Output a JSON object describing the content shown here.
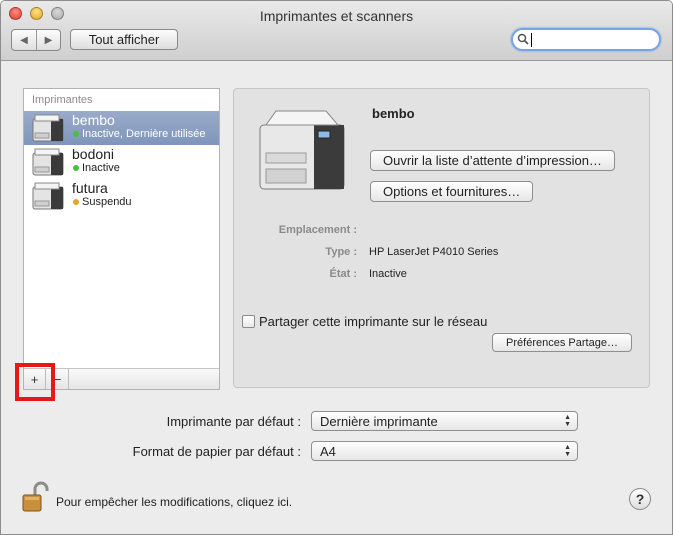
{
  "window": {
    "title": "Imprimantes et scanners"
  },
  "toolbar": {
    "back_icon": "triangle-left-icon",
    "forward_icon": "triangle-right-icon",
    "show_all_label": "Tout afficher",
    "search_value": ""
  },
  "printers_list": {
    "header": "Imprimantes",
    "items": [
      {
        "name": "bembo",
        "status": "Inactive, Dernière utilisée",
        "status_color": "#4bbf3f",
        "selected": true
      },
      {
        "name": "bodoni",
        "status": "Inactive",
        "status_color": "#4bbf3f",
        "selected": false
      },
      {
        "name": "futura",
        "status": "Suspendu",
        "status_color": "#e3a823",
        "selected": false
      }
    ],
    "add_label": "+",
    "remove_label": "−"
  },
  "detail": {
    "printer_name": "bembo",
    "open_queue_label": "Ouvrir la liste d’attente d’impression…",
    "options_label": "Options et fournitures…",
    "location_label": "Emplacement :",
    "location_value": "",
    "type_label": "Type :",
    "type_value": "HP LaserJet P4010 Series",
    "state_label": "État :",
    "state_value": "Inactive",
    "share_label": "Partager cette imprimante sur le réseau",
    "share_checked": false,
    "sharing_prefs_label": "Préférences Partage…"
  },
  "defaults": {
    "printer_label": "Imprimante par défaut :",
    "printer_value": "Dernière imprimante",
    "paper_label": "Format de papier par défaut :",
    "paper_value": "A4"
  },
  "footer": {
    "lock_text": "Pour empêcher les modifications, cliquez ici.",
    "help_label": "?"
  },
  "colors": {
    "selection": "#8a9ec3",
    "highlight_box": "#e5191c",
    "search_focus": "#78a5e2"
  }
}
